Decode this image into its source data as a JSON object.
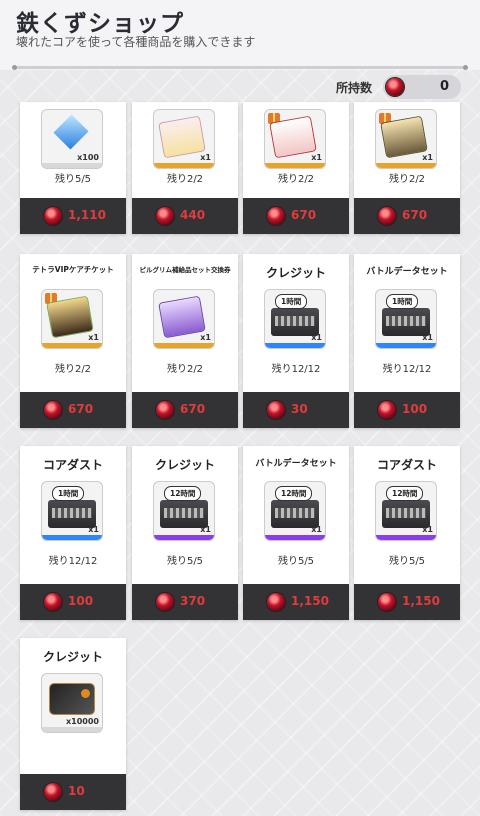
{
  "header": {
    "title": "鉄くずショップ",
    "subtitle": "壊れたコアを使って各種商品を購入できます"
  },
  "wallet": {
    "label": "所持数",
    "count": "0"
  },
  "colors": {
    "price": "#e23b3b",
    "blue_strip": "#2d86ff",
    "purple_strip": "#8a3cf0",
    "gold_strip": "#e7a42b"
  },
  "items": [
    {
      "name": "",
      "qty": "x100",
      "stock": "残り5/5",
      "price": "1,110",
      "time": ""
    },
    {
      "name": "",
      "qty": "x1",
      "stock": "残り2/2",
      "price": "440",
      "time": ""
    },
    {
      "name": "",
      "qty": "x1",
      "stock": "残り2/2",
      "price": "670",
      "time": ""
    },
    {
      "name": "",
      "qty": "x1",
      "stock": "残り2/2",
      "price": "670",
      "time": ""
    },
    {
      "name": "テトラVIPケアチケット",
      "qty": "x1",
      "stock": "残り2/2",
      "price": "670",
      "time": ""
    },
    {
      "name": "ピルグリム補給品セット交換券",
      "qty": "x1",
      "stock": "残り2/2",
      "price": "670",
      "time": ""
    },
    {
      "name": "クレジット",
      "qty": "x1",
      "stock": "残り12/12",
      "price": "30",
      "time": "1時間"
    },
    {
      "name": "バトルデータセット",
      "qty": "x1",
      "stock": "残り12/12",
      "price": "100",
      "time": "1時間"
    },
    {
      "name": "コアダスト",
      "qty": "x1",
      "stock": "残り12/12",
      "price": "100",
      "time": "1時間"
    },
    {
      "name": "クレジット",
      "qty": "x1",
      "stock": "残り5/5",
      "price": "370",
      "time": "12時間"
    },
    {
      "name": "バトルデータセット",
      "qty": "x1",
      "stock": "残り5/5",
      "price": "1,150",
      "time": "12時間"
    },
    {
      "name": "コアダスト",
      "qty": "x1",
      "stock": "残り5/5",
      "price": "1,150",
      "time": "12時間"
    },
    {
      "name": "クレジット",
      "qty": "x10000",
      "stock": "",
      "price": "10",
      "time": ""
    }
  ]
}
